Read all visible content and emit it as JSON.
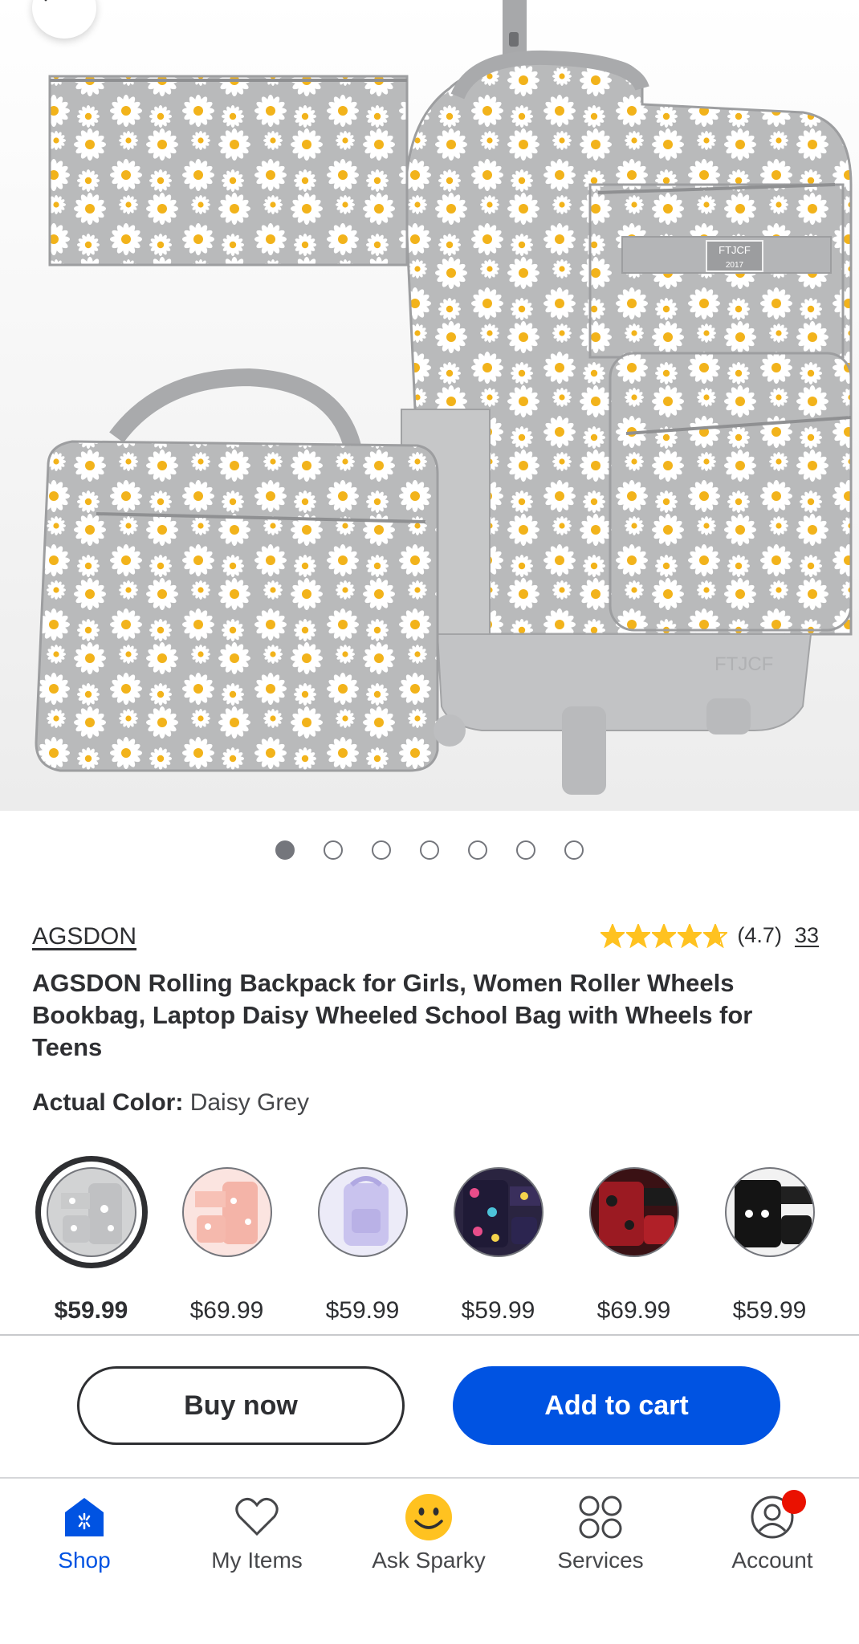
{
  "product": {
    "brand": "AGSDON",
    "rating": "(4.7)",
    "review_count": "33",
    "stars": 4.7,
    "title": "AGSDON Rolling Backpack for Girls, Women Roller Wheels Bookbag, Laptop Daisy Wheeled School Bag with Wheels for Teens",
    "color_label": "Actual Color:",
    "color_value": "Daisy Grey"
  },
  "gallery": {
    "image_count": 7,
    "active_index": 0,
    "image_labels": [
      "FTJCF",
      "2017"
    ]
  },
  "variants": [
    {
      "price": "$59.99",
      "selected": true,
      "swatch": "daisy-grey"
    },
    {
      "price": "$69.99",
      "selected": false,
      "swatch": "pink-daisy"
    },
    {
      "price": "$59.99",
      "selected": false,
      "swatch": "lavender"
    },
    {
      "price": "$59.99",
      "selected": false,
      "swatch": "navy-floral"
    },
    {
      "price": "$69.99",
      "selected": false,
      "swatch": "red-black"
    },
    {
      "price": "$59.99",
      "selected": false,
      "swatch": "black"
    }
  ],
  "actions": {
    "buy_now": "Buy now",
    "add_to_cart": "Add to cart"
  },
  "tabbar": [
    {
      "label": "Shop",
      "icon": "shop-icon",
      "active": true
    },
    {
      "label": "My Items",
      "icon": "heart-icon",
      "active": false
    },
    {
      "label": "Ask Sparky",
      "icon": "sparky-icon",
      "active": false
    },
    {
      "label": "Services",
      "icon": "services-icon",
      "active": false
    },
    {
      "label": "Account",
      "icon": "account-icon",
      "active": false
    }
  ],
  "colors": {
    "accent": "#0053e2",
    "star": "#ffc220",
    "badge": "#ea1100",
    "text": "#2e2f32"
  }
}
